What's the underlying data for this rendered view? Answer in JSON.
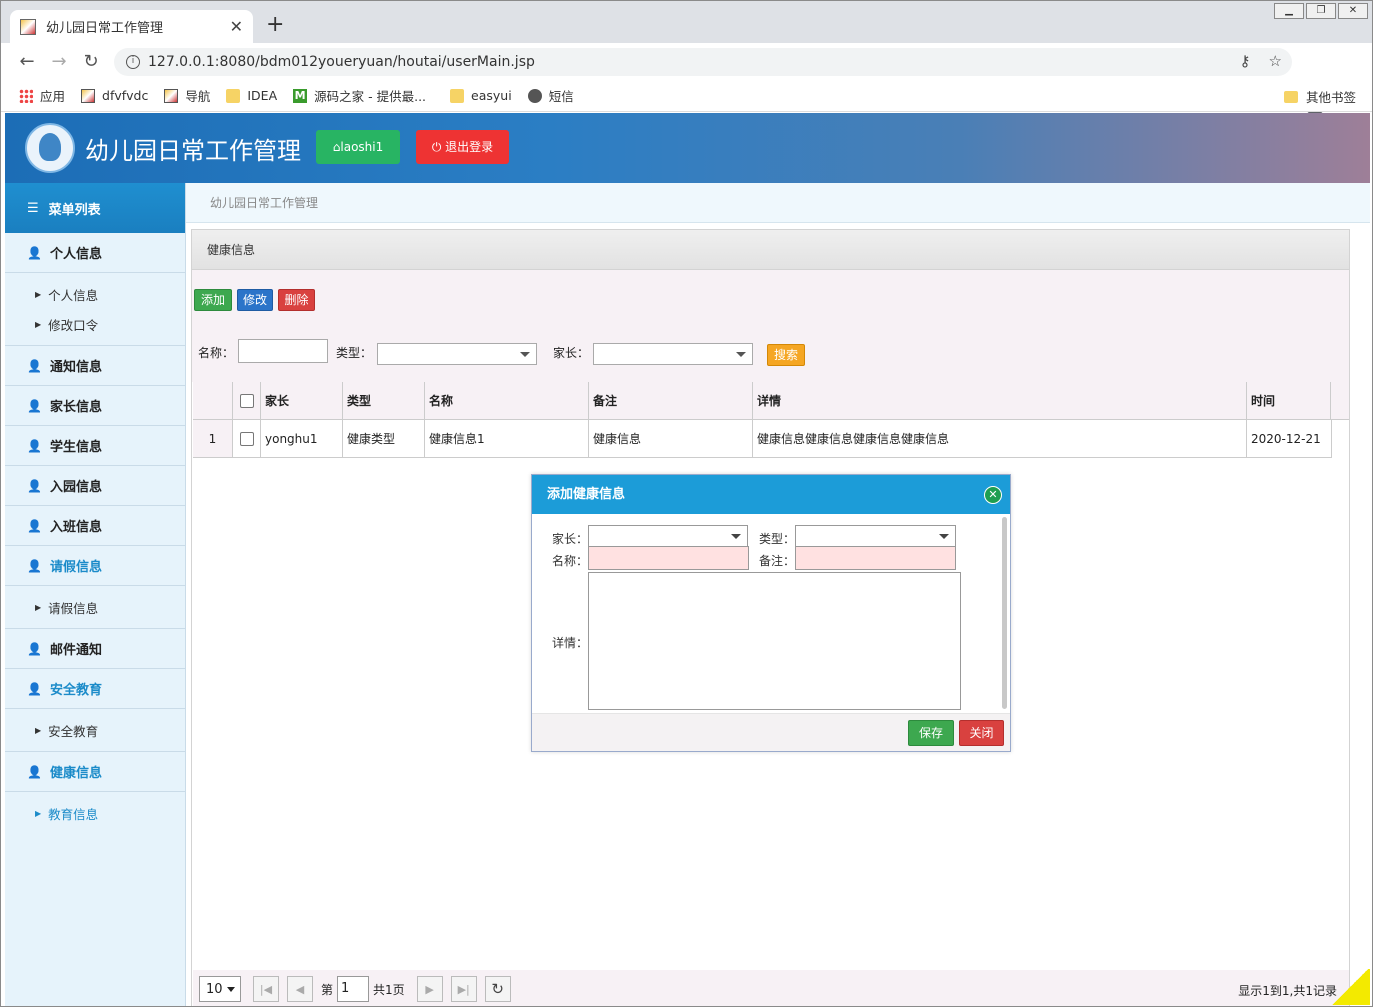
{
  "browser": {
    "tab_title": "幼儿园日常工作管理",
    "url": "127.0.0.1:8080/bdm012youeryuan/houtai/userMain.jsp",
    "bookmarks": [
      "应用",
      "dfvfvdc",
      "导航",
      "IDEA",
      "源码之家 - 提供最...",
      "easyui",
      "短信"
    ],
    "other_bookmarks": "其他书签"
  },
  "header": {
    "title": "幼儿园日常工作管理",
    "user_button": "laoshi1",
    "logout_button": "退出登录",
    "colors": {
      "user_button": "#28b463",
      "logout_button": "#e33333",
      "header_bg": "#1c6db6"
    }
  },
  "sidebar": {
    "heading": "菜单列表",
    "groups": [
      {
        "label": "个人信息",
        "active": false,
        "subs": [
          "个人信息",
          "修改口令"
        ]
      },
      {
        "label": "通知信息"
      },
      {
        "label": "家长信息"
      },
      {
        "label": "学生信息"
      },
      {
        "label": "入园信息"
      },
      {
        "label": "入班信息"
      },
      {
        "label": "请假信息",
        "active": true,
        "subs": [
          "请假信息"
        ]
      },
      {
        "label": "邮件通知"
      },
      {
        "label": "安全教育",
        "active": true,
        "subs": [
          "安全教育"
        ]
      },
      {
        "label": "健康信息",
        "active": true,
        "subs": [
          "教育信息"
        ]
      }
    ]
  },
  "breadcrumb": "幼儿园日常工作管理",
  "panel": {
    "title": "健康信息",
    "toolbar": {
      "add": "添加",
      "edit": "修改",
      "delete": "删除"
    },
    "filters": {
      "name_label": "名称：",
      "type_label": "类型：",
      "parent_label": "家长：",
      "search": "搜索"
    },
    "columns": [
      "家长",
      "类型",
      "名称",
      "备注",
      "详情",
      "时间"
    ],
    "rows": [
      {
        "num": "1",
        "cells": [
          "yonghu1",
          "健康类型",
          "健康信息1",
          "健康信息",
          "健康信息健康信息健康信息健康信息",
          "2020-12-21"
        ]
      }
    ],
    "pager": {
      "page_size": "10",
      "page_prefix": "第",
      "page_num": "1",
      "page_suffix": "共1页",
      "info": "显示1到1,共1记录"
    }
  },
  "dialog": {
    "title": "添加健康信息",
    "parent_label": "家长：",
    "type_label": "类型：",
    "name_label": "名称：",
    "remark_label": "备注：",
    "detail_label": "详情：",
    "save": "保存",
    "close": "关闭"
  }
}
